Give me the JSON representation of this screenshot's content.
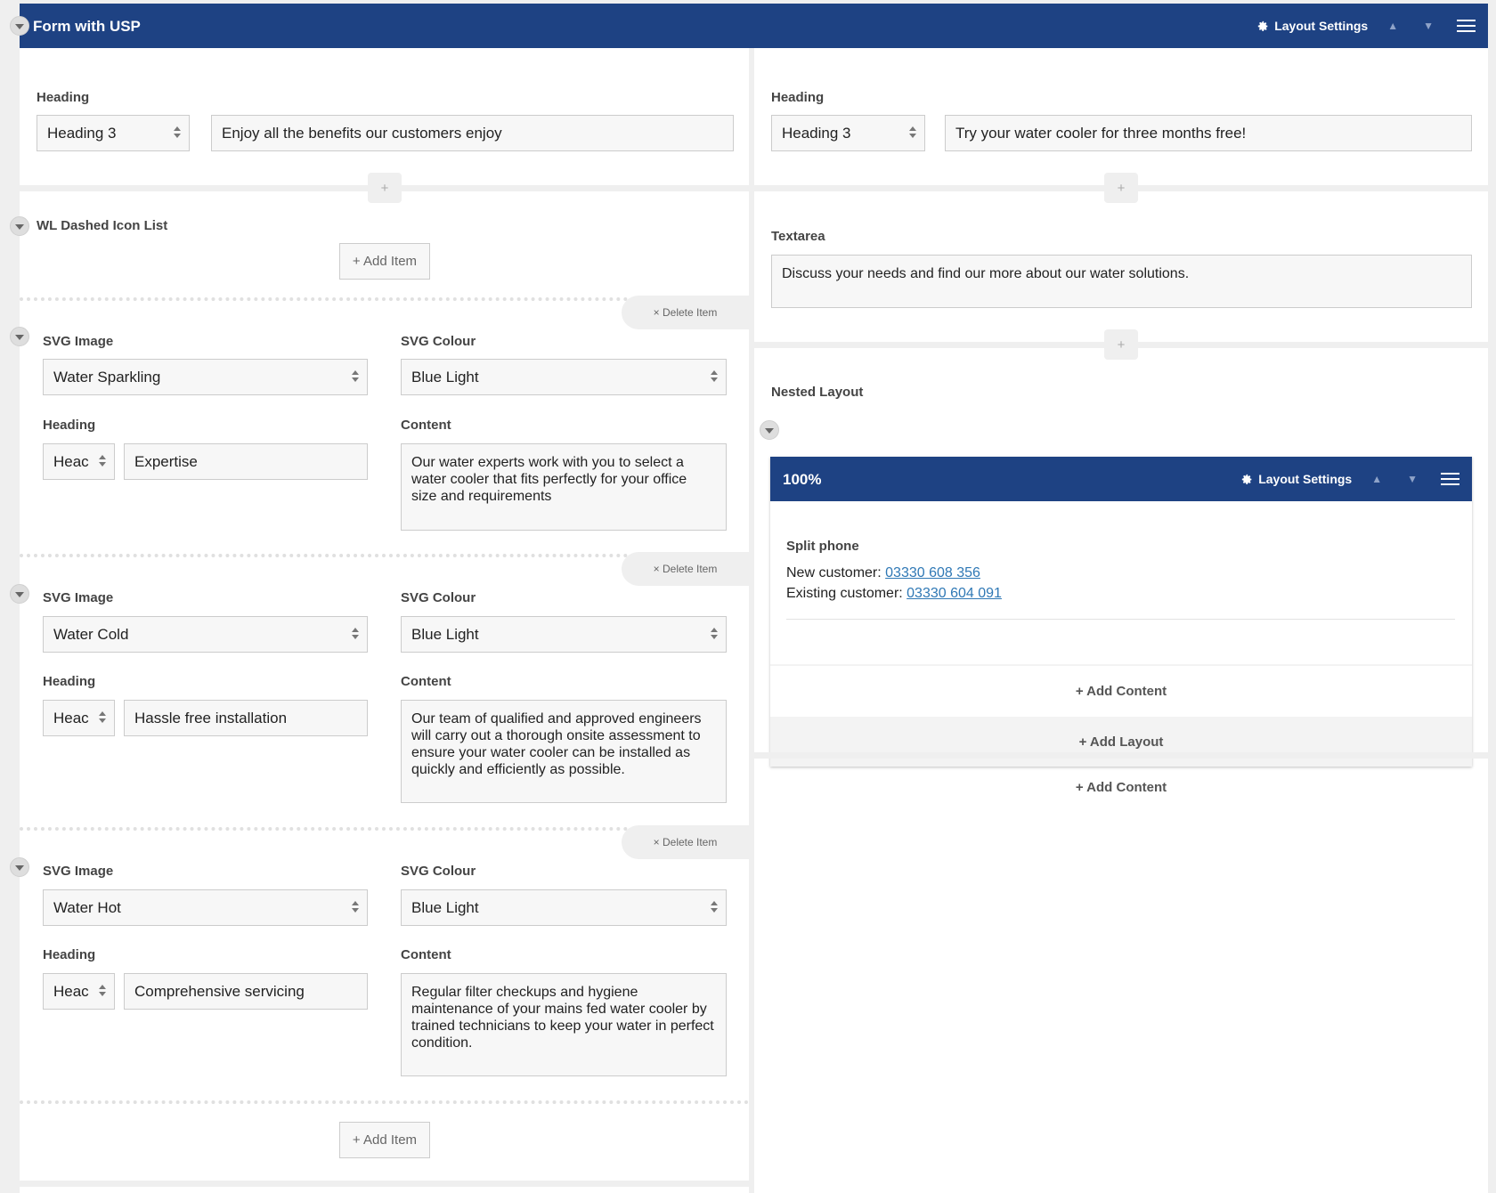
{
  "header": {
    "title": "Form with USP",
    "layout_settings": "Layout Settings"
  },
  "left": {
    "heading_label": "Heading",
    "heading_level": "Heading 3",
    "heading_text": "Enjoy all the benefits our customers enjoy",
    "icon_list_label": "WL Dashed Icon List",
    "add_item": "+ Add Item",
    "delete_item": "× Delete Item",
    "svg_image_label": "SVG Image",
    "svg_colour_label": "SVG Colour",
    "item_heading_label": "Heading",
    "content_label": "Content",
    "items": [
      {
        "svg_image": "Water Sparkling",
        "svg_colour": "Blue Light",
        "heading_level": "Heac",
        "heading": "Expertise",
        "content": "Our water experts work with you to select a water cooler that fits perfectly for your office size and requirements"
      },
      {
        "svg_image": "Water Cold",
        "svg_colour": "Blue Light",
        "heading_level": "Heac",
        "heading": "Hassle free installation",
        "content": "Our team of qualified and approved engineers will carry out a thorough onsite assessment to ensure your water cooler can be installed as quickly and efficiently as possible."
      },
      {
        "svg_image": "Water Hot",
        "svg_colour": "Blue Light",
        "heading_level": "Heac",
        "heading": "Comprehensive servicing",
        "content": "Regular filter checkups and hygiene maintenance of your mains fed water cooler by trained technicians to keep your water in perfect condition."
      }
    ]
  },
  "right": {
    "heading_label": "Heading",
    "heading_level": "Heading 3",
    "heading_text": "Try your water cooler for three months free!",
    "textarea_label": "Textarea",
    "textarea_text": "Discuss your needs and find our more about our water solutions.",
    "nested_label": "Nested Layout",
    "nested": {
      "title": "100%",
      "layout_settings": "Layout Settings",
      "split_phone_label": "Split phone",
      "new_customer_label": "New customer: ",
      "new_customer_phone": "03330 608 356",
      "existing_customer_label": "Existing customer: ",
      "existing_customer_phone": "03330 604 091",
      "add_content": "+ Add Content",
      "add_layout": "+ Add Layout"
    },
    "add_content": "+ Add Content"
  },
  "plus": "+",
  "icons": {
    "gear": "gear-icon",
    "up": "arrow-up-icon",
    "down": "arrow-down-icon",
    "menu": "hamburger-menu-icon",
    "collapse": "collapse-toggle-icon"
  },
  "colors": {
    "header_bg": "#1e4283",
    "link": "#2f78b5"
  }
}
